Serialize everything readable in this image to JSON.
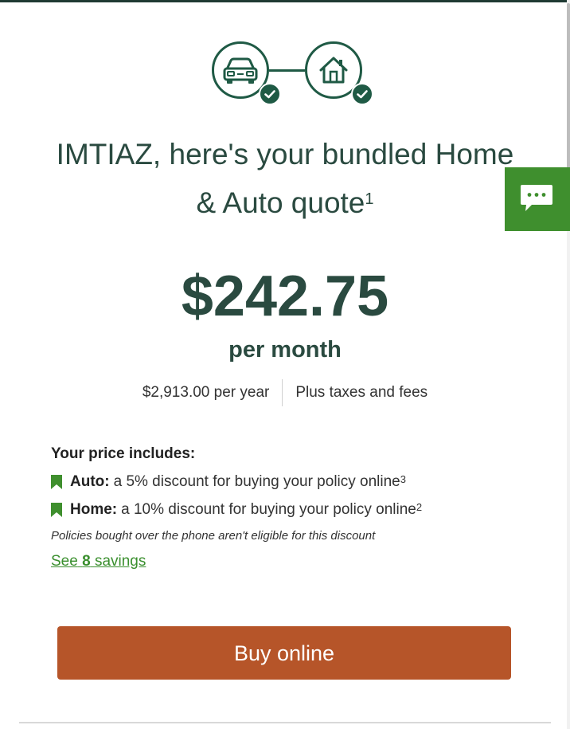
{
  "hero": {
    "icons": [
      "car-icon",
      "home-icon",
      "check-icon"
    ],
    "title_line1": "IMTIAZ, here's your bundled Home",
    "title_line2": "& Auto quote",
    "title_footnote": "1"
  },
  "pricing": {
    "monthly_price": "$242.75",
    "per_month_label": "per month",
    "yearly_price": "$2,913.00 per year",
    "taxes_note": "Plus taxes and fees"
  },
  "includes": {
    "heading": "Your price includes:",
    "items": [
      {
        "label": "Auto:",
        "text": "a 5% discount for buying your policy online",
        "footnote": "3"
      },
      {
        "label": "Home:",
        "text": "a 10% discount for buying your policy online",
        "footnote": "2"
      }
    ],
    "disclaimer": "Policies bought over the phone aren't eligible for this discount",
    "savings_link_prefix": "See",
    "savings_count": "8",
    "savings_link_suffix": "savings"
  },
  "actions": {
    "buy_label": "Buy online"
  },
  "colors": {
    "brand_dark_green": "#1f5a45",
    "heading_green": "#2a4a40",
    "accent_green": "#3f8f2e",
    "buy_button": "#b65529"
  }
}
